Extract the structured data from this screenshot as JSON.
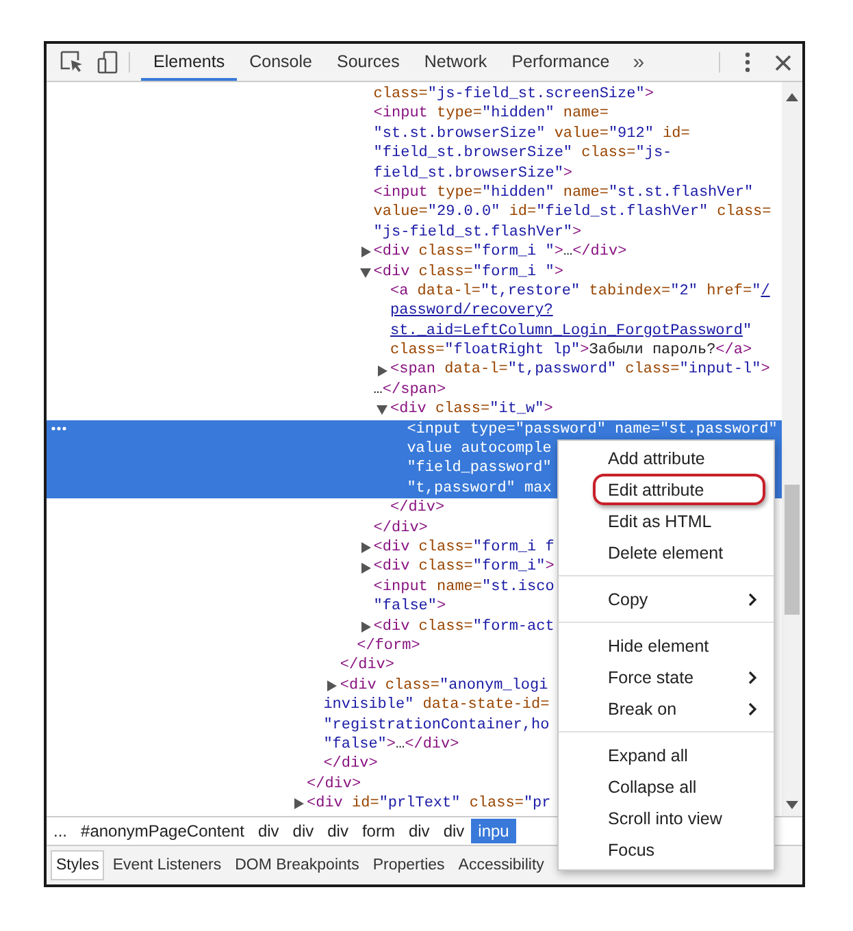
{
  "toolbar": {
    "tabs": [
      {
        "label": "Elements",
        "selected": true
      },
      {
        "label": "Console",
        "selected": false
      },
      {
        "label": "Sources",
        "selected": false
      },
      {
        "label": "Network",
        "selected": false
      },
      {
        "label": "Performance",
        "selected": false
      }
    ],
    "overflow": "»"
  },
  "dom": {
    "lines": [
      {
        "selected": false,
        "parts": [
          {
            "kind": "attr",
            "text": "class="
          },
          {
            "kind": "val",
            "text": "\"js-field_st.screenSize\""
          },
          {
            "kind": "tag",
            "text": ">"
          }
        ]
      },
      {
        "selected": false,
        "parts": [
          {
            "kind": "tag",
            "text": "<input"
          },
          {
            "kind": "attr",
            "text": " type="
          },
          {
            "kind": "val",
            "text": "\"hidden\""
          },
          {
            "kind": "attr",
            "text": " name="
          }
        ]
      },
      {
        "selected": false,
        "parts": [
          {
            "kind": "val",
            "text": "\"st.st.browserSize\""
          },
          {
            "kind": "attr",
            "text": " value="
          },
          {
            "kind": "val",
            "text": "\"912\""
          },
          {
            "kind": "attr",
            "text": " id="
          }
        ]
      },
      {
        "selected": false,
        "parts": [
          {
            "kind": "val",
            "text": "\"field_st.browserSize\""
          },
          {
            "kind": "attr",
            "text": " class="
          },
          {
            "kind": "val",
            "text": "\"js-"
          }
        ]
      },
      {
        "selected": false,
        "parts": [
          {
            "kind": "val",
            "text": "field_st.browserSize\""
          },
          {
            "kind": "tag",
            "text": ">"
          }
        ]
      },
      {
        "selected": false,
        "parts": [
          {
            "kind": "tag",
            "text": "<input"
          },
          {
            "kind": "attr",
            "text": " type="
          },
          {
            "kind": "val",
            "text": "\"hidden\""
          },
          {
            "kind": "attr",
            "text": " name="
          },
          {
            "kind": "val",
            "text": "\"st.st.flashVer\""
          }
        ]
      },
      {
        "selected": false,
        "parts": [
          {
            "kind": "attr",
            "text": "value="
          },
          {
            "kind": "val",
            "text": "\"29.0.0\""
          },
          {
            "kind": "attr",
            "text": " id="
          },
          {
            "kind": "val",
            "text": "\"field_st.flashVer\""
          },
          {
            "kind": "attr",
            "text": " class="
          }
        ]
      },
      {
        "selected": false,
        "parts": [
          {
            "kind": "val",
            "text": "\"js-field_st.flashVer\""
          },
          {
            "kind": "tag",
            "text": ">"
          }
        ]
      },
      {
        "selected": false,
        "expanded": false,
        "parts": [
          {
            "kind": "tag",
            "text": "<div"
          },
          {
            "kind": "attr",
            "text": " class="
          },
          {
            "kind": "val",
            "text": "\"form_i \""
          },
          {
            "kind": "tag",
            "text": ">"
          },
          {
            "kind": "text",
            "text": "…"
          },
          {
            "kind": "tag",
            "text": "</div>"
          }
        ]
      },
      {
        "selected": false,
        "expanded": true,
        "parts": [
          {
            "kind": "tag",
            "text": "<div"
          },
          {
            "kind": "attr",
            "text": " class="
          },
          {
            "kind": "val",
            "text": "\"form_i \""
          },
          {
            "kind": "tag",
            "text": ">"
          }
        ]
      },
      {
        "selected": false,
        "parts": [
          {
            "kind": "tag",
            "text": "<a"
          },
          {
            "kind": "attr",
            "text": " data-l="
          },
          {
            "kind": "val",
            "text": "\"t,restore\""
          },
          {
            "kind": "attr",
            "text": " tabindex="
          },
          {
            "kind": "val",
            "text": "\"2\""
          },
          {
            "kind": "attr",
            "text": " href="
          },
          {
            "kind": "val",
            "text": "\""
          },
          {
            "kind": "link",
            "text": "/"
          }
        ]
      },
      {
        "selected": false,
        "parts": [
          {
            "kind": "link",
            "text": "password/recovery?"
          }
        ]
      },
      {
        "selected": false,
        "parts": [
          {
            "kind": "link",
            "text": "st._aid=LeftColumn_Login_ForgotPassword"
          },
          {
            "kind": "val",
            "text": "\""
          }
        ]
      },
      {
        "selected": false,
        "parts": [
          {
            "kind": "attr",
            "text": "class="
          },
          {
            "kind": "val",
            "text": "\"floatRight lp\""
          },
          {
            "kind": "tag",
            "text": ">"
          },
          {
            "kind": "text",
            "text": "Забыли пароль?"
          },
          {
            "kind": "tag",
            "text": "</a>"
          }
        ]
      },
      {
        "selected": false,
        "expanded": false,
        "parts": [
          {
            "kind": "tag",
            "text": "<span"
          },
          {
            "kind": "attr",
            "text": " data-l="
          },
          {
            "kind": "val",
            "text": "\"t,password\""
          },
          {
            "kind": "attr",
            "text": " class="
          },
          {
            "kind": "val",
            "text": "\"input-l\""
          },
          {
            "kind": "tag",
            "text": ">"
          }
        ]
      },
      {
        "selected": false,
        "parts": [
          {
            "kind": "text",
            "text": "…"
          },
          {
            "kind": "tag",
            "text": "</span>"
          }
        ]
      },
      {
        "selected": false,
        "expanded": true,
        "parts": [
          {
            "kind": "tag",
            "text": "<div"
          },
          {
            "kind": "attr",
            "text": " class="
          },
          {
            "kind": "val",
            "text": "\"it_w\""
          },
          {
            "kind": "tag",
            "text": ">"
          }
        ]
      },
      {
        "selected": true,
        "parts": [
          {
            "kind": "tag",
            "text": "<input"
          },
          {
            "kind": "attr",
            "text": " type="
          },
          {
            "kind": "val",
            "text": "\"password\""
          },
          {
            "kind": "attr",
            "text": " name="
          },
          {
            "kind": "val",
            "text": "\"st.password\""
          }
        ]
      },
      {
        "selected": true,
        "parts": [
          {
            "kind": "attr",
            "text": "value autocomple"
          }
        ]
      },
      {
        "selected": true,
        "parts": [
          {
            "kind": "val",
            "text": "\"field_password\""
          }
        ]
      },
      {
        "selected": true,
        "parts": [
          {
            "kind": "val",
            "text": "\"t,password\""
          },
          {
            "kind": "attr",
            "text": " max"
          }
        ]
      },
      {
        "selected": false,
        "parts": [
          {
            "kind": "tag",
            "text": "</div>"
          }
        ]
      },
      {
        "selected": false,
        "parts": [
          {
            "kind": "tag",
            "text": "</div>"
          }
        ]
      },
      {
        "selected": false,
        "expanded": false,
        "parts": [
          {
            "kind": "tag",
            "text": "<div"
          },
          {
            "kind": "attr",
            "text": " class="
          },
          {
            "kind": "val",
            "text": "\"form_i f"
          }
        ]
      },
      {
        "selected": false,
        "expanded": false,
        "parts": [
          {
            "kind": "tag",
            "text": "<div"
          },
          {
            "kind": "attr",
            "text": " class="
          },
          {
            "kind": "val",
            "text": "\"form_i\""
          },
          {
            "kind": "tag",
            "text": ">"
          }
        ]
      },
      {
        "selected": false,
        "parts": [
          {
            "kind": "tag",
            "text": "<input"
          },
          {
            "kind": "attr",
            "text": " name="
          },
          {
            "kind": "val",
            "text": "\"st.isco"
          }
        ]
      },
      {
        "selected": false,
        "parts": [
          {
            "kind": "val",
            "text": "\"false\""
          },
          {
            "kind": "tag",
            "text": ">"
          }
        ]
      },
      {
        "selected": false,
        "expanded": false,
        "parts": [
          {
            "kind": "tag",
            "text": "<div"
          },
          {
            "kind": "attr",
            "text": " class="
          },
          {
            "kind": "val",
            "text": "\"form-act"
          }
        ]
      },
      {
        "selected": false,
        "parts": [
          {
            "kind": "tag",
            "text": "</form>"
          }
        ]
      },
      {
        "selected": false,
        "parts": [
          {
            "kind": "tag",
            "text": "</div>"
          }
        ]
      },
      {
        "selected": false,
        "expanded": false,
        "parts": [
          {
            "kind": "tag",
            "text": "<div"
          },
          {
            "kind": "attr",
            "text": " class="
          },
          {
            "kind": "val",
            "text": "\"anonym_logi"
          }
        ]
      },
      {
        "selected": false,
        "parts": [
          {
            "kind": "val",
            "text": "invisible\""
          },
          {
            "kind": "attr",
            "text": " data-state-id="
          }
        ]
      },
      {
        "selected": false,
        "parts": [
          {
            "kind": "val",
            "text": "\"registrationContainer,ho"
          }
        ]
      },
      {
        "selected": false,
        "parts": [
          {
            "kind": "val",
            "text": "\"false\""
          },
          {
            "kind": "tag",
            "text": ">"
          },
          {
            "kind": "text",
            "text": "…"
          },
          {
            "kind": "tag",
            "text": "</div>"
          }
        ]
      },
      {
        "selected": false,
        "parts": [
          {
            "kind": "tag",
            "text": "</div>"
          }
        ]
      },
      {
        "selected": false,
        "parts": [
          {
            "kind": "tag",
            "text": "</div>"
          }
        ]
      },
      {
        "selected": false,
        "expanded": false,
        "parts": [
          {
            "kind": "tag",
            "text": "<div"
          },
          {
            "kind": "attr",
            "text": " id="
          },
          {
            "kind": "val",
            "text": "\"prlText\""
          },
          {
            "kind": "attr",
            "text": " class="
          },
          {
            "kind": "val",
            "text": "\"pr"
          }
        ]
      }
    ]
  },
  "breadcrumbs": [
    {
      "label": "...",
      "selected": false
    },
    {
      "label": "#anonymPageContent",
      "selected": false
    },
    {
      "label": "div",
      "selected": false
    },
    {
      "label": "div",
      "selected": false
    },
    {
      "label": "div",
      "selected": false
    },
    {
      "label": "form",
      "selected": false
    },
    {
      "label": "div",
      "selected": false
    },
    {
      "label": "div",
      "selected": false
    },
    {
      "label": "inpu",
      "selected": true
    }
  ],
  "panel_tabs": [
    {
      "label": "Styles",
      "selected": true
    },
    {
      "label": "Event Listeners",
      "selected": false
    },
    {
      "label": "DOM Breakpoints",
      "selected": false
    },
    {
      "label": "Properties",
      "selected": false
    },
    {
      "label": "Accessibility",
      "selected": false
    }
  ],
  "context_menu": {
    "groups": [
      [
        {
          "label": "Add attribute",
          "submenu": false,
          "highlighted": false
        },
        {
          "label": "Edit attribute",
          "submenu": false,
          "highlighted": true
        },
        {
          "label": "Edit as HTML",
          "submenu": false,
          "highlighted": false
        },
        {
          "label": "Delete element",
          "submenu": false,
          "highlighted": false
        }
      ],
      [
        {
          "label": "Copy",
          "submenu": true,
          "highlighted": false
        }
      ],
      [
        {
          "label": "Hide element",
          "submenu": false,
          "highlighted": false
        },
        {
          "label": "Force state",
          "submenu": true,
          "highlighted": false
        },
        {
          "label": "Break on",
          "submenu": true,
          "highlighted": false
        }
      ],
      [
        {
          "label": "Expand all",
          "submenu": false,
          "highlighted": false
        },
        {
          "label": "Collapse all",
          "submenu": false,
          "highlighted": false
        },
        {
          "label": "Scroll into view",
          "submenu": false,
          "highlighted": false
        },
        {
          "label": "Focus",
          "submenu": false,
          "highlighted": false
        }
      ]
    ]
  }
}
